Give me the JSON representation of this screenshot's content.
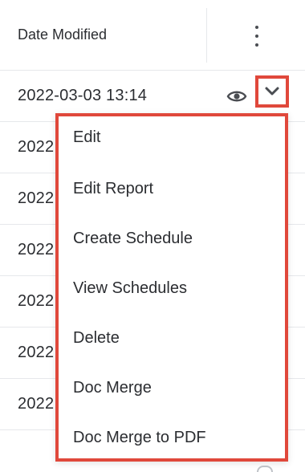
{
  "column": {
    "header": "Date Modified"
  },
  "rows": [
    {
      "date_modified": "2022-03-03 13:14"
    },
    {
      "date_modified": "2022"
    },
    {
      "date_modified": "2022"
    },
    {
      "date_modified": "2022"
    },
    {
      "date_modified": "2022"
    },
    {
      "date_modified": "2022"
    },
    {
      "date_modified": "2022"
    }
  ],
  "menu": {
    "items": [
      {
        "label": "Edit"
      },
      {
        "label": "Edit Report"
      },
      {
        "label": "Create Schedule"
      },
      {
        "label": "View Schedules"
      },
      {
        "label": "Delete"
      },
      {
        "label": "Doc Merge"
      },
      {
        "label": "Doc Merge to PDF"
      }
    ]
  },
  "icons": {
    "column_actions": "kebab-vertical-icon",
    "preview": "eye-icon",
    "dropdown": "chevron-down-icon"
  },
  "colors": {
    "highlight": "#e0483b",
    "text": "#2b2d31",
    "divider": "#e6e8eb"
  }
}
